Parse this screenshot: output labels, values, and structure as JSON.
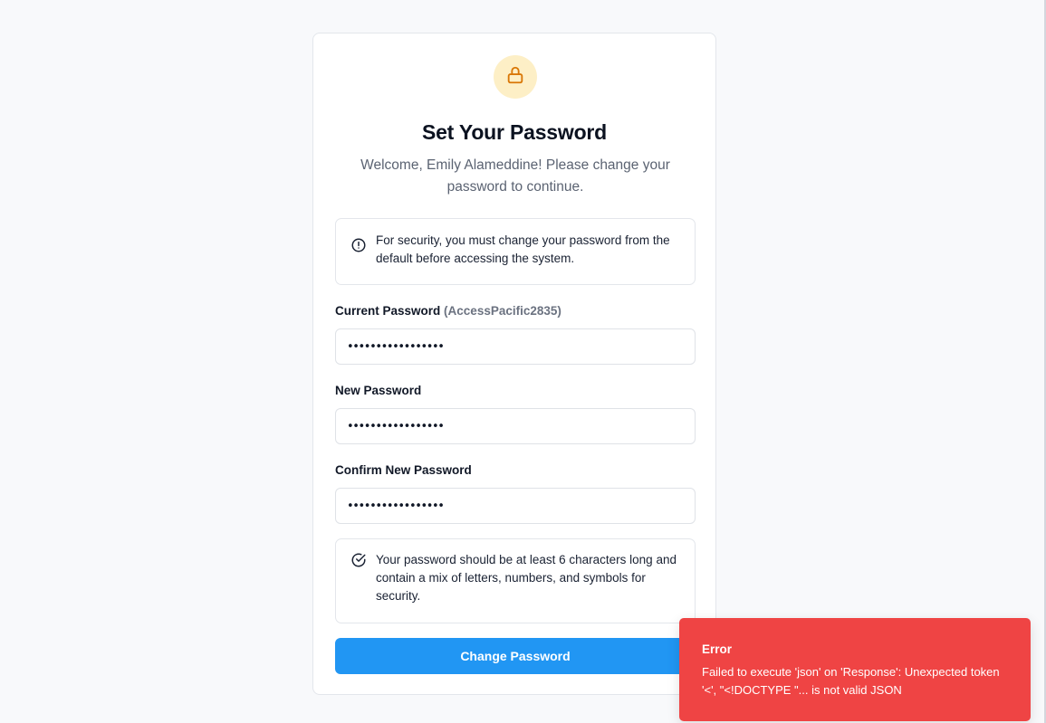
{
  "colors": {
    "primary": "#2196f3",
    "error": "#ef4444",
    "lock_bg": "#fdefc6",
    "lock_icon": "#d97706"
  },
  "header": {
    "icon": "lock-icon",
    "title": "Set Your Password",
    "subtitle": "Welcome, Emily Alameddine! Please change your password to continue."
  },
  "security_notice": {
    "icon": "alert-circle-icon",
    "text": "For security, you must change your password from the default before accessing the system."
  },
  "form": {
    "current_password": {
      "label": "Current Password",
      "hint": "(AccessPacific2835)",
      "value": "•••••••••••••••••"
    },
    "new_password": {
      "label": "New Password",
      "value": "•••••••••••••••••"
    },
    "confirm_password": {
      "label": "Confirm New Password",
      "value": "•••••••••••••••••"
    },
    "submit_label": "Change Password"
  },
  "password_rules": {
    "icon": "check-circle-icon",
    "text": "Your password should be at least 6 characters long and contain a mix of letters, numbers, and symbols for security."
  },
  "toast": {
    "title": "Error",
    "message": "Failed to execute 'json' on 'Response': Unexpected token '<', \"<!DOCTYPE \"... is not valid JSON"
  }
}
